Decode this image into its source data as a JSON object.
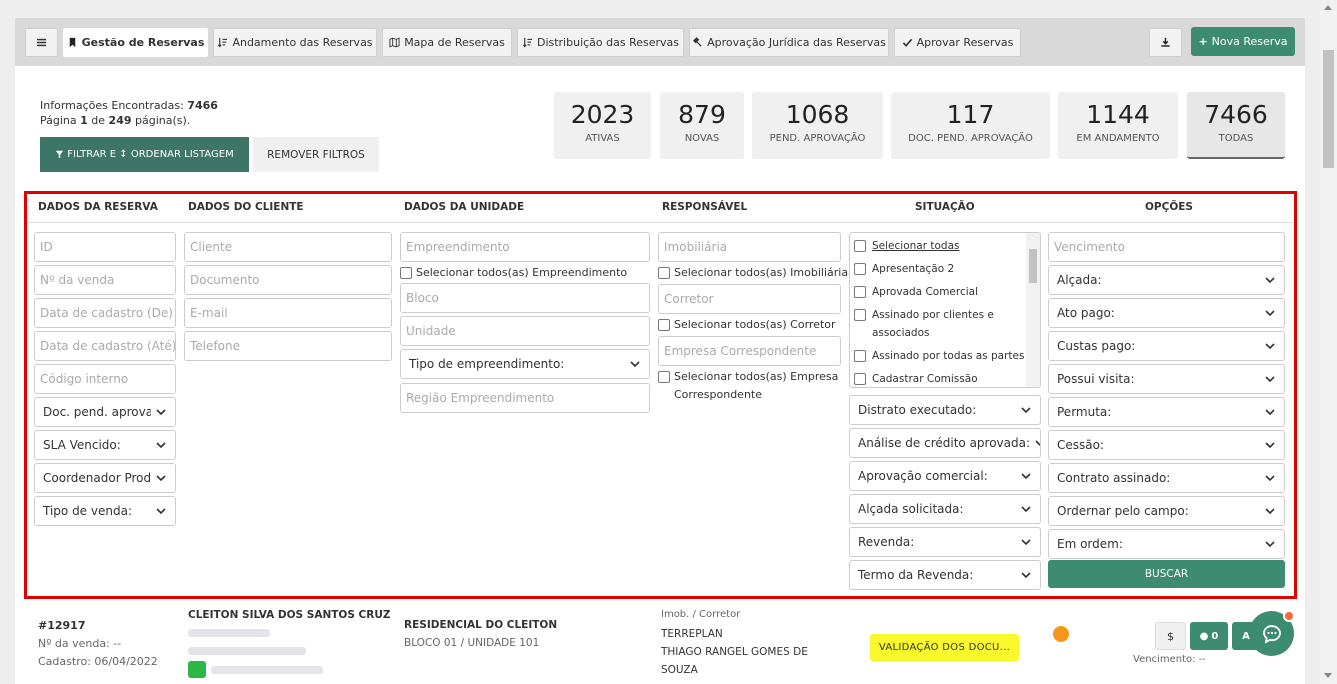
{
  "tabs": {
    "menu_icon": "hamburger-icon",
    "items": [
      {
        "label": "Gestão de Reservas",
        "icon": "bookmark-icon",
        "active": true
      },
      {
        "label": "Andamento das Reservas",
        "icon": "sort-icon"
      },
      {
        "label": "Mapa de Reservas",
        "icon": "map-icon"
      },
      {
        "label": "Distribuição das Reservas",
        "icon": "sort-icon"
      },
      {
        "label": "Aprovação Jurídica das Reservas",
        "icon": "gavel-icon"
      },
      {
        "label": "Aprovar Reservas",
        "icon": "check-icon"
      }
    ],
    "download_icon": "download-icon",
    "new_reservation": "Nova Reserva"
  },
  "info": {
    "found_label": "Informações Encontradas:",
    "found_count": "7466",
    "page_prefix": "Página",
    "page_current": "1",
    "page_of": "de",
    "page_total": "249",
    "page_suffix": "página(s)."
  },
  "buttons": {
    "filter": "FILTRAR E ↕ ORDENAR LISTAGEM",
    "remove_filters": "REMOVER FILTROS",
    "search": "BUSCAR"
  },
  "stats": [
    {
      "value": "2023",
      "label": "ATIVAS"
    },
    {
      "value": "879",
      "label": "NOVAS"
    },
    {
      "value": "1068",
      "label": "PEND. APROVAÇÃO"
    },
    {
      "value": "117",
      "label": "DOC. PEND. APROVAÇÃO"
    },
    {
      "value": "1144",
      "label": "EM ANDAMENTO"
    },
    {
      "value": "7466",
      "label": "TODAS",
      "active": true
    }
  ],
  "filters": {
    "headers": {
      "reserva": "DADOS DA RESERVA",
      "cliente": "DADOS DO CLIENTE",
      "unidade": "DADOS DA UNIDADE",
      "responsavel": "RESPONSÁVEL",
      "situacao": "SITUAÇÃO",
      "opcoes": "OPÇÕES"
    },
    "reserva_inputs": [
      "ID",
      "Nº da venda",
      "Data de cadastro (De)",
      "Data de cadastro (Até)",
      "Código interno"
    ],
    "reserva_selects": [
      "Doc. pend. aprovação",
      "SLA Vencido:",
      "Coordenador Produto",
      "Tipo de venda:"
    ],
    "cliente_inputs": [
      "Cliente",
      "Documento",
      "E-mail",
      "Telefone"
    ],
    "unidade": {
      "empreendimento": "Empreendimento",
      "select_all_empreendimento": "Selecionar todos(as) Empreendimento",
      "bloco": "Bloco",
      "unidade": "Unidade",
      "tipo_select": "Tipo de empreendimento:",
      "regiao": "Região Empreendimento"
    },
    "responsavel": {
      "imobiliaria": "Imobiliária",
      "select_all_imobiliaria": "Selecionar todos(as) Imobiliária",
      "corretor": "Corretor",
      "select_all_corretor": "Selecionar todos(as) Corretor",
      "empresa": "Empresa Correspondente",
      "select_all_empresa": "Selecionar todos(as) Empresa Correspondente"
    },
    "situacao_list": [
      "Selecionar todas",
      "Apresentação 2",
      "Aprovada Comercial",
      "Assinado por clientes e associados",
      "Assinado por todas as partes",
      "Cadastrar Comissão"
    ],
    "situacao_selects": [
      "Distrato executado:",
      "Análise de crédito aprovada:",
      "Aprovação comercial:",
      "Alçada solicitada:",
      "Revenda:",
      "Termo da Revenda:"
    ],
    "opcoes_input": "Vencimento",
    "opcoes_selects": [
      "Alçada:",
      "Ato pago:",
      "Custas pago:",
      "Possui visita:",
      "Permuta:",
      "Cessão:",
      "Contrato assinado:",
      "Ordernar pelo campo:",
      "Em ordem:"
    ]
  },
  "row": {
    "id": "#12917",
    "sale_label": "Nº da venda: --",
    "created_label": "Cadastro: 06/04/2022",
    "client_name": "CLEITON SILVA DOS SANTOS CRUZ",
    "project": "RESIDENCIAL DO CLEITON",
    "unit": "BLOCO 01 / UNIDADE 101",
    "imob_label": "Imob. / Corretor",
    "imob": "TERREPLAN",
    "corretor_line1": "THIAGO RANGEL GOMES DE",
    "corretor_line2": "SOUZA",
    "status": "VALIDAÇÃO DOS DOCU...",
    "dollar": "$",
    "comments": "0",
    "action_short": "A",
    "vencimento": "Vencimento: --"
  },
  "colors": {
    "accent": "#3d8c72",
    "highlight": "#e00000",
    "status_yellow": "#f8f82a",
    "dot_orange": "#f5951d"
  }
}
